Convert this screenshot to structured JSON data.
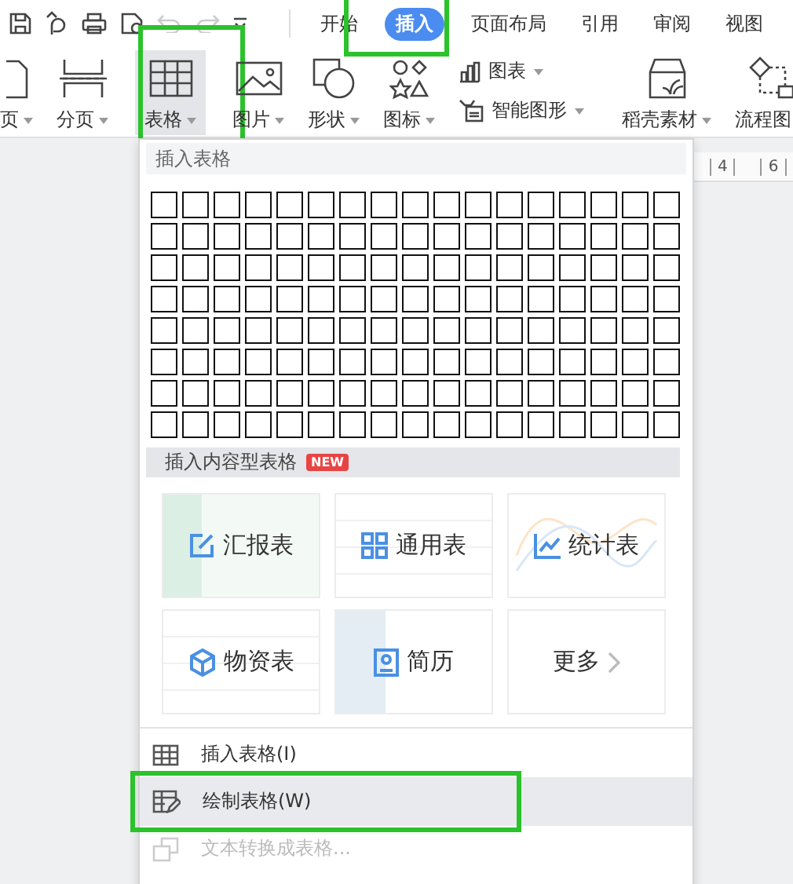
{
  "tabs": [
    {
      "label": "开始",
      "selected": false,
      "highlighted": false
    },
    {
      "label": "插入",
      "selected": true,
      "highlighted": true
    },
    {
      "label": "页面布局",
      "selected": false,
      "highlighted": false
    },
    {
      "label": "引用",
      "selected": false,
      "highlighted": false
    },
    {
      "label": "审阅",
      "selected": false,
      "highlighted": false
    },
    {
      "label": "视图",
      "selected": false,
      "highlighted": false
    }
  ],
  "ribbon": [
    {
      "kind": "header",
      "label": "页",
      "pressed": false,
      "highlighted": false
    },
    {
      "kind": "page-break",
      "label": "分页",
      "pressed": false,
      "highlighted": false
    },
    {
      "kind": "table",
      "label": "表格",
      "pressed": true,
      "highlighted": true
    },
    {
      "kind": "picture",
      "label": "图片",
      "pressed": false,
      "highlighted": false
    },
    {
      "kind": "shape",
      "label": "形状",
      "pressed": false,
      "highlighted": false
    },
    {
      "kind": "icon-set",
      "label": "图标",
      "pressed": false,
      "highlighted": false
    },
    {
      "kind": "stack",
      "items": [
        {
          "kind": "chart",
          "label": "图表"
        },
        {
          "kind": "smart-art",
          "label": "智能图形"
        }
      ]
    },
    {
      "kind": "material",
      "label": "稻壳素材",
      "pressed": false,
      "highlighted": false
    },
    {
      "kind": "flowchart",
      "label": "流程图",
      "pressed": false,
      "highlighted": false
    }
  ],
  "ruler": {
    "labels": [
      "4",
      "6"
    ]
  },
  "dropdown": {
    "header": "插入表格",
    "content_header": "插入内容型表格",
    "badge": "NEW",
    "cards": [
      {
        "kind": "report",
        "label": "汇报表"
      },
      {
        "kind": "general",
        "label": "通用表"
      },
      {
        "kind": "statistics",
        "label": "统计表"
      },
      {
        "kind": "materials",
        "label": "物资表"
      },
      {
        "kind": "resume",
        "label": "简历"
      },
      {
        "kind": "more",
        "label": "更多"
      }
    ],
    "items": [
      {
        "kind": "insert",
        "label": "插入表格(I)",
        "disabled": false,
        "hovered": false,
        "highlighted": false
      },
      {
        "kind": "draw",
        "label": "绘制表格(W)",
        "disabled": false,
        "hovered": true,
        "highlighted": true
      },
      {
        "kind": "convert",
        "label": "文本转换成表格...",
        "disabled": true,
        "hovered": false,
        "highlighted": false
      }
    ]
  }
}
